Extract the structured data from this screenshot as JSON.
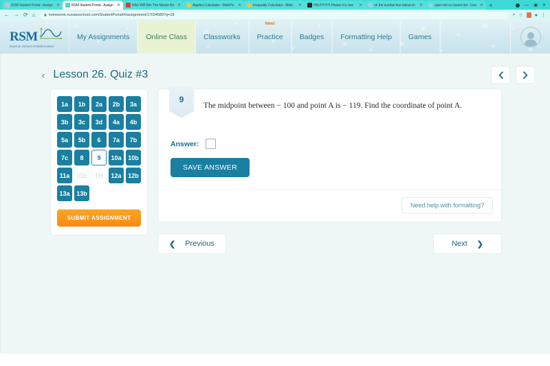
{
  "browser": {
    "tabs": [
      {
        "title": "RSM Student Portal - Assign",
        "favicon": "#b9c6cc",
        "active": false
      },
      {
        "title": "RSM Student Portal - Assign",
        "favicon": "#4fd6d3",
        "active": true
      },
      {
        "title": "Who Will Win The Master Bo",
        "favicon": "#e03b2f",
        "active": false
      },
      {
        "title": "Algebra Calculator - MathPa",
        "favicon": "#f2c53d",
        "active": false
      },
      {
        "title": "Inequality Calculator - Math",
        "favicon": "#f2c53d",
        "active": false
      },
      {
        "title": "HELP!!!!!!!!! Please it is nee",
        "favicon": "#2b2b2b",
        "active": false
      },
      {
        "title": "on the number line below sh",
        "favicon": "#8fd4e8",
        "active": false
      },
      {
        "title": "open dot vs closed dot - Goo",
        "favicon": "#8fd4e8",
        "active": false
      }
    ],
    "new_tab_label": "+",
    "window_minimize": "—",
    "window_maximize": "▣",
    "window_close": "✕",
    "url": "homework.russianschool.com/StudentPortal/#/assignment/17034589?q=18",
    "back_icon": "←",
    "forward_icon": "→",
    "reload_icon": "⟳",
    "home_icon": "⌂",
    "lock_icon": "🔒",
    "zoom_icon": "⌕",
    "star_icon": "☆",
    "menu_icon": "⋮"
  },
  "header": {
    "logo_text": "RSM",
    "logo_subtitle": "Russian School of Mathematics",
    "nav": [
      {
        "label": "My Assignments",
        "active": false,
        "badge": ""
      },
      {
        "label": "Online Class",
        "active": true,
        "badge": ""
      },
      {
        "label": "Classworks",
        "active": false,
        "badge": ""
      },
      {
        "label": "Practice",
        "active": false,
        "badge": "New!"
      },
      {
        "label": "Badges",
        "active": false,
        "badge": ""
      },
      {
        "label": "Formatting Help",
        "active": false,
        "badge": ""
      },
      {
        "label": "Games",
        "active": false,
        "badge": ""
      }
    ],
    "avatar_name": "user-avatar"
  },
  "colors": {
    "teal": "#1a7fa0",
    "orange": "#f58a16",
    "header_green": "#e9f3d4",
    "page_bg": "#eef7f6"
  },
  "lesson": {
    "back_chevron": "‹",
    "title": "Lesson 26. Quiz #3",
    "prev_icon": "‹",
    "next_icon": "›"
  },
  "question_grid": {
    "cells": [
      {
        "label": "1a",
        "state": "answered"
      },
      {
        "label": "1b",
        "state": "answered"
      },
      {
        "label": "2a",
        "state": "answered"
      },
      {
        "label": "2b",
        "state": "answered"
      },
      {
        "label": "3a",
        "state": "answered"
      },
      {
        "label": "3b",
        "state": "answered"
      },
      {
        "label": "3c",
        "state": "answered"
      },
      {
        "label": "3d",
        "state": "answered"
      },
      {
        "label": "4a",
        "state": "answered"
      },
      {
        "label": "4b",
        "state": "answered"
      },
      {
        "label": "5a",
        "state": "answered"
      },
      {
        "label": "5b",
        "state": "answered"
      },
      {
        "label": "6",
        "state": "answered"
      },
      {
        "label": "7a",
        "state": "answered"
      },
      {
        "label": "7b",
        "state": "answered"
      },
      {
        "label": "7c",
        "state": "answered"
      },
      {
        "label": "8",
        "state": "answered"
      },
      {
        "label": "9",
        "state": "current"
      },
      {
        "label": "10a",
        "state": "answered"
      },
      {
        "label": "10b",
        "state": "answered"
      },
      {
        "label": "11a",
        "state": "answered"
      },
      {
        "label": "11b",
        "state": "unanswered"
      },
      {
        "label": "TH",
        "state": "unanswered"
      },
      {
        "label": "12a",
        "state": "answered"
      },
      {
        "label": "12b",
        "state": "answered"
      },
      {
        "label": "13a",
        "state": "answered"
      },
      {
        "label": "13b",
        "state": "answered"
      },
      {
        "label": "",
        "state": "empty"
      },
      {
        "label": "",
        "state": "empty"
      },
      {
        "label": "",
        "state": "empty"
      }
    ],
    "submit_label": "SUBMIT ASSIGNMENT"
  },
  "question": {
    "number": "9",
    "text": "The midpoint between − 100 and  point A  is − 119. Find the coordinate of point A.",
    "answer_label": "Answer:",
    "answer_value": "",
    "answer_placeholder": "",
    "save_label": "SAVE ANSWER",
    "format_help_label": "Need help with formatting?"
  },
  "pager": {
    "previous_label": "Previous",
    "previous_icon": "❮",
    "next_label": "Next",
    "next_icon": "❯"
  }
}
